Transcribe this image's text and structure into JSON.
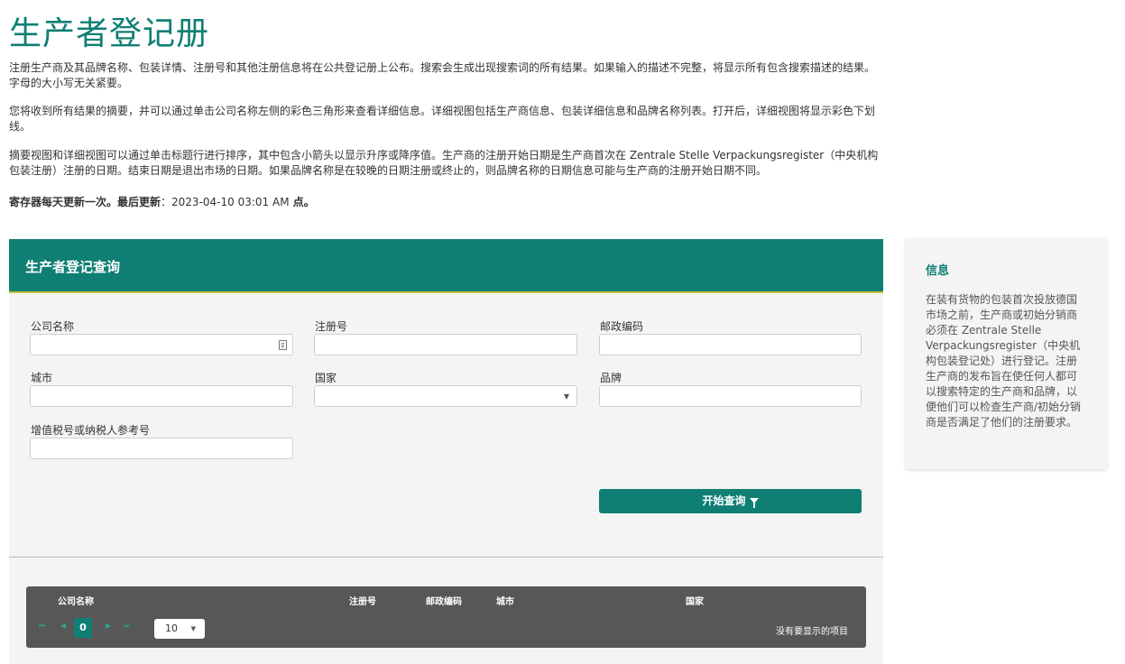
{
  "page": {
    "title": "生产者登记册",
    "intro1": "注册生产商及其品牌名称、包装详情、注册号和其他注册信息将在公共登记册上公布。搜索会生成出现搜索词的所有结果。如果输入的描述不完整，将显示所有包含搜索描述的结果。字母的大小写无关紧要。",
    "intro2": "您将收到所有结果的摘要，并可以通过单击公司名称左侧的彩色三角形来查看详细信息。详细视图包括生产商信息、包装详细信息和品牌名称列表。打开后，详细视图将显示彩色下划线。",
    "intro3": "摘要视图和详细视图可以通过单击标题行进行排序，其中包含小箭头以显示升序或降序值。生产商的注册开始日期是生产商首次在 Zentrale Stelle Verpackungsregister（中央机构包装注册）注册的日期。结束日期是退出市场的日期。如果品牌名称是在较晚的日期注册或终止的，则品牌名称的日期信息可能与生产商的注册开始日期不同。",
    "update_prefix": "寄存器每天更新一次。最后更新",
    "update_colon": "：",
    "update_value": "2023-04-10 03:01 AM",
    "update_suffix": " 点。"
  },
  "form": {
    "title": "生产者登记查询",
    "company_label": "公司名称",
    "regno_label": "注册号",
    "postal_label": "邮政编码",
    "city_label": "城市",
    "country_label": "国家",
    "brand_label": "品牌",
    "vat_label": "增值税号或纳税人参考号",
    "search_button": "开始查询"
  },
  "grid": {
    "columns": [
      "公司名称",
      "注册号",
      "邮政编码",
      "城市",
      "国家"
    ],
    "current_page": "0",
    "page_size": "10",
    "empty_message": "没有要显示的项目"
  },
  "info": {
    "title": "信息",
    "text": "在装有货物的包装首次投放德国市场之前，生产商或初始分销商必须在 Zentrale Stelle Verpackungsregister（中央机构包装登记处）进行登记。注册生产商的发布旨在使任何人都可以搜索特定的生产商和品牌，以便他们可以检查生产商/初始分销商是否满足了他们的注册要求。"
  },
  "colors": {
    "primary": "#0f7f74",
    "accent_line": "#c9c43a",
    "grid_header": "#575757",
    "panel_bg": "#f4f4f4"
  }
}
